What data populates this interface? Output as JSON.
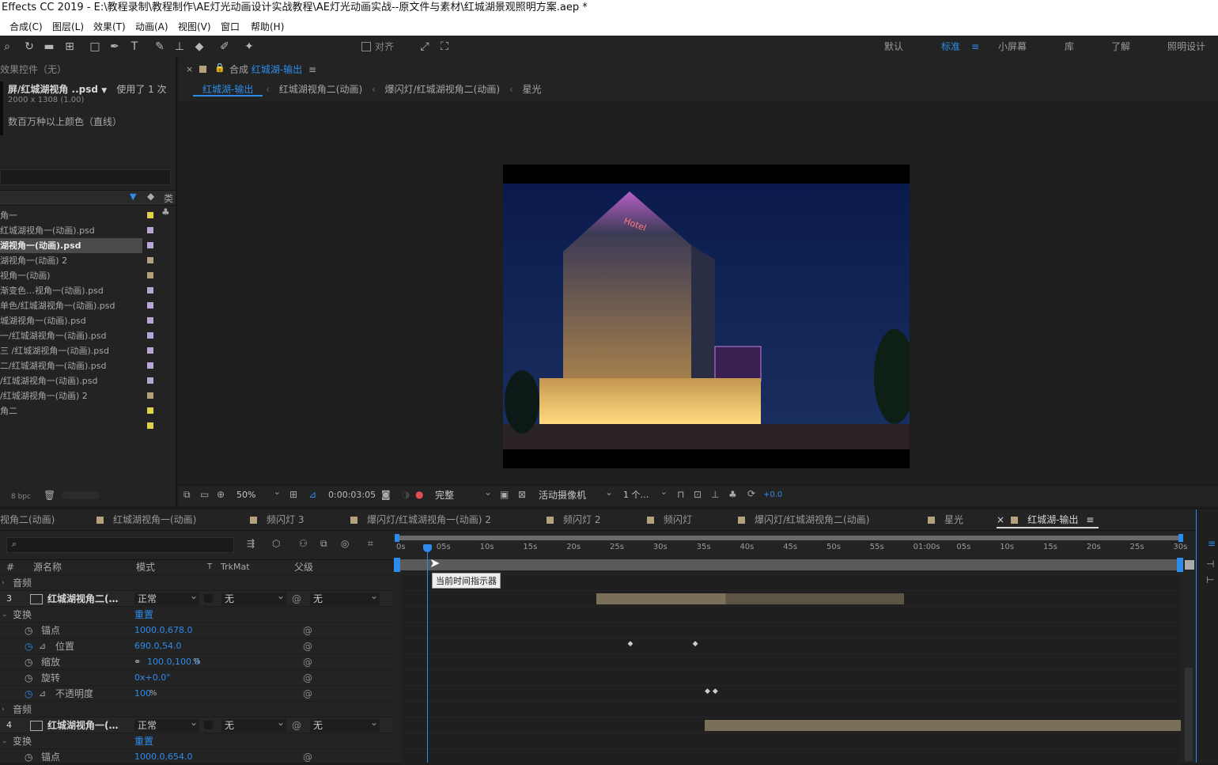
{
  "window": {
    "title": "Effects CC 2019 - E:\\教程录制\\教程制作\\AE灯光动画设计实战教程\\AE灯光动画实战--原文件与素材\\红城湖景观照明方案.aep *"
  },
  "menu": [
    "合成(C)",
    "图层(L)",
    "效果(T)",
    "动画(A)",
    "视图(V)",
    "窗口",
    "帮助(H)"
  ],
  "toolbar": {
    "snap_label": "对齐"
  },
  "workspaces": {
    "items": [
      "默认",
      "标准",
      "小屏幕",
      "库",
      "了解",
      "照明设计"
    ],
    "active": "标准"
  },
  "effect_controls": {
    "title": "效果控件（无）"
  },
  "project": {
    "selected_name": "屏/红城湖视角 ..psd",
    "used_text": "使用了 1 次",
    "dimensions": "2000 x 1308 (1.00)",
    "color_info": "数百万种以上颜色（直线）",
    "type_header": "类",
    "bpc": "8 bpc",
    "items": [
      {
        "name": "角一",
        "color": "#e0d34a"
      },
      {
        "name": "红城湖视角一(动画).psd",
        "color": "#b6a6d6"
      },
      {
        "name": "湖视角一(动画).psd",
        "color": "#b6a6d6",
        "selected": true
      },
      {
        "name": "湖视角一(动画) 2",
        "color": "#b3a27c"
      },
      {
        "name": "视角一(动画)",
        "color": "#b3a27c"
      },
      {
        "name": "渐变色…视角一(动画).psd",
        "color": "#b6a6d6"
      },
      {
        "name": "单色/红城湖视角一(动画).psd",
        "color": "#b6a6d6"
      },
      {
        "name": "城湖视角一(动画).psd",
        "color": "#b6a6d6"
      },
      {
        "name": "一/红城湖视角一(动画).psd",
        "color": "#b6a6d6"
      },
      {
        "name": "三 /红城湖视角一(动画).psd",
        "color": "#b6a6d6"
      },
      {
        "name": "二/红城湖视角一(动画).psd",
        "color": "#b6a6d6"
      },
      {
        "name": "/红城湖视角一(动画).psd",
        "color": "#b6a6d6"
      },
      {
        "name": "/红城湖视角一(动画) 2",
        "color": "#b3a27c"
      },
      {
        "name": "角二",
        "color": "#e0d34a"
      },
      {
        "name": "",
        "color": "#e0d34a"
      }
    ]
  },
  "composition": {
    "panel_label": "合成",
    "name": "红城湖-输出",
    "breadcrumbs": [
      "红城湖-输出",
      "红城湖视角二(动画)",
      "爆闪灯/红城湖视角二(动画)",
      "星光"
    ],
    "footer": {
      "zoom": "50%",
      "timecode": "0:00:03:05",
      "resolution": "完整",
      "camera": "活动摄像机",
      "views": "1 个…",
      "exposure": "+0.0"
    },
    "building_sign": "Hotel"
  },
  "timeline": {
    "tabs": [
      "视角二(动画)",
      "红城湖视角一(动画)",
      "频闪灯 3",
      "爆闪灯/红城湖视角一(动画) 2",
      "频闪灯 2",
      "频闪灯",
      "爆闪灯/红城湖视角二(动画)",
      "星光",
      "红城湖-输出"
    ],
    "active_tab": "红城湖-输出",
    "columns": {
      "num": "#",
      "source": "源名称",
      "mode": "模式",
      "t": "T",
      "trkmat": "TrkMat",
      "parent": "父级"
    },
    "ruler_ticks": [
      "0s",
      "05s",
      "10s",
      "15s",
      "20s",
      "25s",
      "30s",
      "35s",
      "40s",
      "45s",
      "50s",
      "55s",
      "01:00s",
      "05s",
      "10s",
      "15s",
      "20s",
      "25s",
      "30s"
    ],
    "tooltip": "当前时间指示器",
    "layers": [
      {
        "audio_label": "音频"
      },
      {
        "number": "3",
        "name": "红城湖视角二(…",
        "mode": "正常",
        "trkmat": "无",
        "parent": "无"
      },
      {
        "group": "变换",
        "reset": "重置"
      },
      {
        "prop": "锚点",
        "value": "1000.0,678.0"
      },
      {
        "prop": "位置",
        "value": "690.0,54.0"
      },
      {
        "prop": "缩放",
        "value": "100.0,100.0",
        "unit": "%"
      },
      {
        "prop": "旋转",
        "value": "0x+0.0°"
      },
      {
        "prop": "不透明度",
        "value": "100",
        "unit": "%"
      },
      {
        "audio_label": "音频"
      },
      {
        "number": "4",
        "name": "红城湖视角一(…",
        "mode": "正常",
        "trkmat": "无",
        "parent": "无"
      },
      {
        "group": "变换",
        "reset": "重置"
      },
      {
        "prop": "锚点",
        "value": "1000.0,654.0"
      }
    ],
    "current_time_seconds": 3.2
  }
}
